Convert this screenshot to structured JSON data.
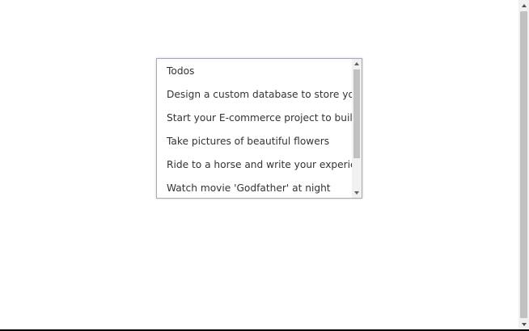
{
  "todo_list": {
    "items": [
      "Todos",
      "Design a custom database to store your data",
      "Start your E-commerce project to build",
      "Take pictures of beautiful flowers",
      "Ride to a horse and write your experience",
      "Watch movie 'Godfather' at night"
    ],
    "scroll_position": 0
  },
  "icons": {
    "list_scroll_up": "triangle-up-icon",
    "list_scroll_down": "triangle-down-icon",
    "page_scroll_up": "triangle-up-icon",
    "page_scroll_down": "triangle-down-icon"
  },
  "colors": {
    "text": "#333333",
    "border": "#a9a9b5",
    "scrollbar_track": "#f1f1f1",
    "scrollbar_thumb": "#c1c1c1"
  }
}
